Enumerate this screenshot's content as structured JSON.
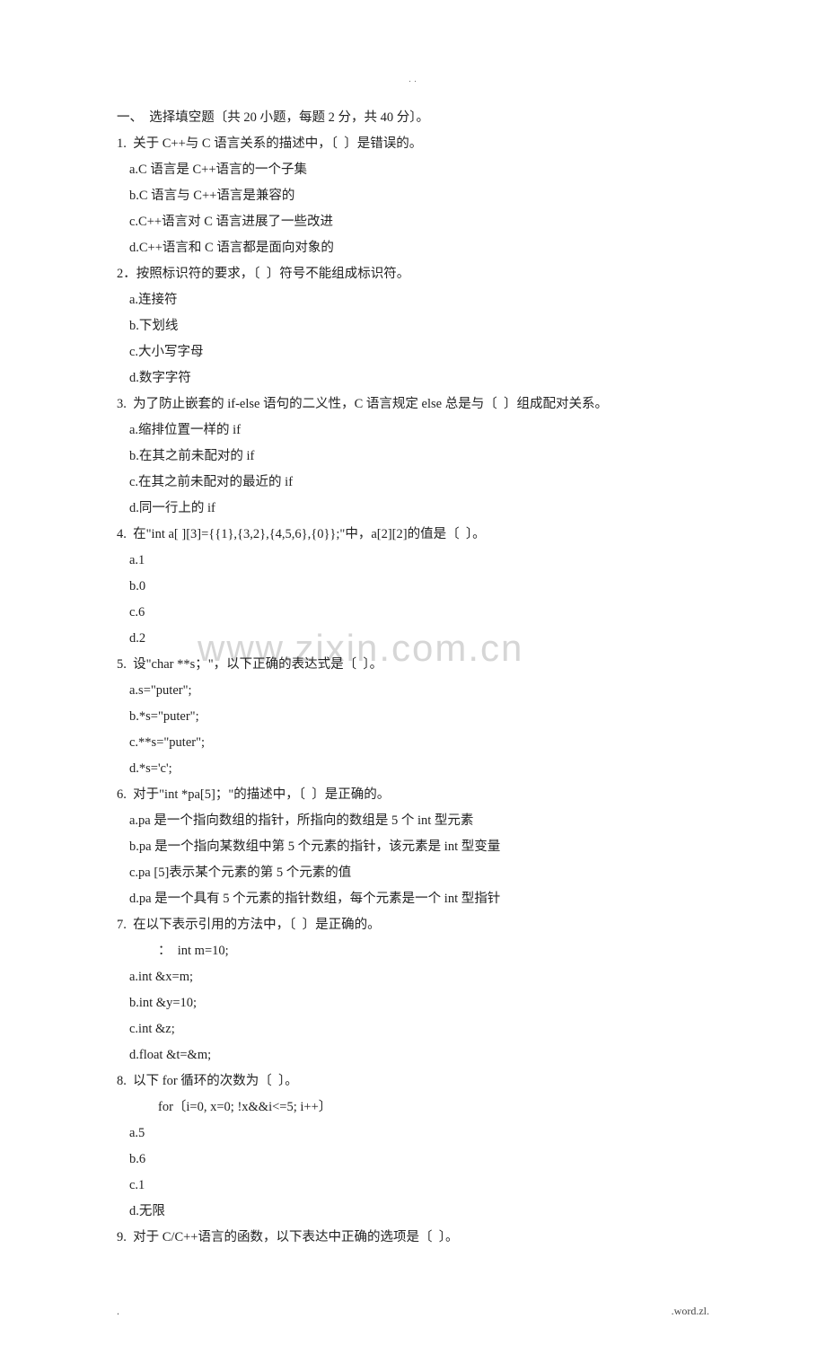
{
  "watermark": "www.zixin.com.cn",
  "header_dots": ".\n.",
  "footer_left": ".",
  "footer_right": ".word.zl.",
  "section_title": "一、  选择填空题〔共 20 小题，每题 2 分，共 40 分〕。",
  "questions": [
    {
      "stem": "1.  关于 C++与 C 语言关系的描述中，〔  〕是错误的。",
      "opts": [
        "a.C 语言是 C++语言的一个子集",
        "b.C 语言与 C++语言是兼容的",
        "c.C++语言对 C 语言进展了一些改进",
        "d.C++语言和 C 语言都是面向对象的"
      ]
    },
    {
      "stem": "2．按照标识符的要求，〔  〕符号不能组成标识符。",
      "opts": [
        "a.连接符",
        "b.下划线",
        "c.大小写字母",
        "d.数字字符"
      ]
    },
    {
      "stem": "3.  为了防止嵌套的 if-else 语句的二义性，C 语言规定 else 总是与〔  〕组成配对关系。",
      "opts": [
        "a.缩排位置一样的 if",
        "b.在其之前未配对的 if",
        "c.在其之前未配对的最近的 if",
        "d.同一行上的 if"
      ]
    },
    {
      "stem": "4.  在\"int a[ ][3]={{1},{3,2},{4,5,6},{0}};\"中，a[2][2]的值是〔  〕。",
      "opts": [
        "a.1",
        "b.0",
        "c.6",
        "d.2"
      ]
    },
    {
      "stem": "5.  设\"char **s；\"，以下正确的表达式是〔  〕。",
      "opts": [
        "a.s=\"puter\";",
        "b.*s=\"puter\";",
        "c.**s=\"puter\";",
        "d.*s='c';"
      ]
    },
    {
      "stem": "6.  对于\"int *pa[5]；\"的描述中，〔  〕是正确的。",
      "opts": [
        "a.pa 是一个指向数组的指针，所指向的数组是 5 个 int 型元素",
        "b.pa 是一个指向某数组中第 5 个元素的指针，该元素是 int 型变量",
        "c.pa [5]表示某个元素的第 5 个元素的值",
        "d.pa 是一个具有 5 个元素的指针数组，每个元素是一个 int 型指针"
      ]
    },
    {
      "stem": "7.  在以下表示引用的方法中，〔  〕是正确的。",
      "sub": "：  int m=10;",
      "opts": [
        "a.int &x=m;",
        "b.int &y=10;",
        "c.int &z;",
        "d.float &t=&m;"
      ]
    },
    {
      "stem": "8.  以下 for 循环的次数为〔  〕。",
      "sub": "for〔i=0, x=0; !x&&i<=5; i++〕",
      "opts": [
        "a.5",
        "b.6",
        "c.1",
        "d.无限"
      ]
    },
    {
      "stem": "9.  对于 C/C++语言的函数，以下表达中正确的选项是〔  〕。",
      "opts": []
    }
  ]
}
